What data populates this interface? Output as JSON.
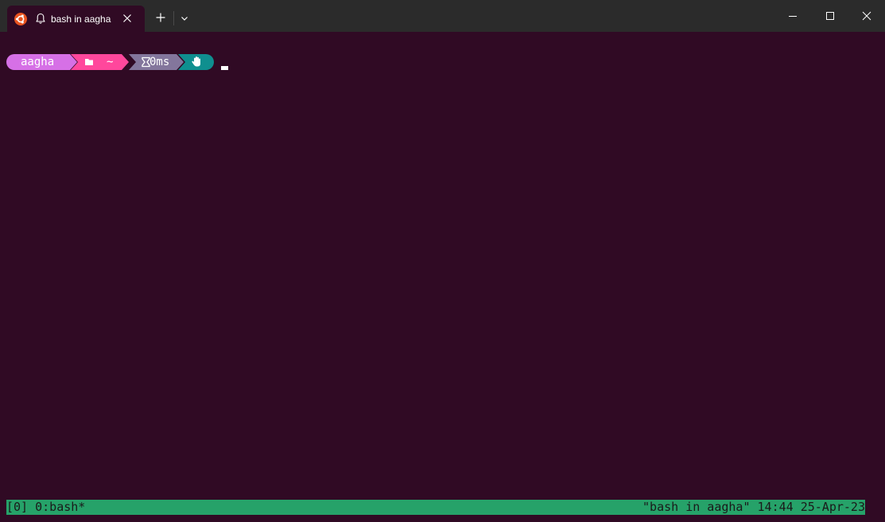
{
  "tab": {
    "title": "bash in aagha",
    "icon": "ubuntu-icon",
    "bell_icon": "bell-icon",
    "close_icon": "close-icon"
  },
  "toolbar": {
    "new_tab_icon": "plus-icon",
    "dropdown_icon": "chevron-down-icon"
  },
  "window_controls": {
    "minimize_icon": "minimize-icon",
    "maximize_icon": "maximize-icon",
    "close_icon": "close-icon"
  },
  "prompt": {
    "user": "aagha",
    "path": "~",
    "duration": "0ms",
    "colors": {
      "user_bg": "#d670e6",
      "path_bg": "#ff479c",
      "time_bg": "#83769c",
      "status_bg": "#0f8f8f"
    }
  },
  "statusbar": {
    "left": "[0] 0:bash*",
    "right": "\"bash in aagha\" 14:44 25-Apr-23",
    "color": "#26a269"
  }
}
